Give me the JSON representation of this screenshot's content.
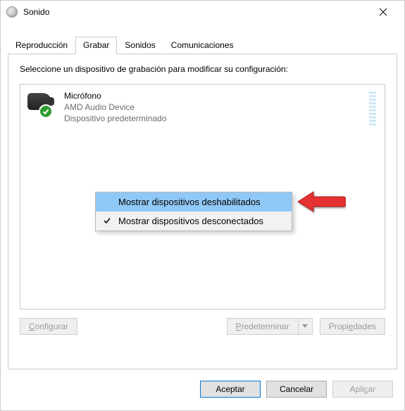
{
  "window": {
    "title": "Sonido"
  },
  "tabs": {
    "playback": "Reproducción",
    "record": "Grabar",
    "sounds": "Sonidos",
    "comms": "Comunicaciones"
  },
  "page": {
    "instruction": "Seleccione un dispositivo de grabación para modificar su configuración:",
    "device": {
      "name": "Micrófono",
      "driver": "AMD Audio Device",
      "status": "Dispositivo predeterminado"
    },
    "buttons": {
      "configure": "Configurar",
      "setdefault": "Predeterminar",
      "properties": "Propiedades"
    }
  },
  "context_menu": {
    "show_disabled": "Mostrar dispositivos deshabilitados",
    "show_disconnected": "Mostrar dispositivos desconectados"
  },
  "dialog_buttons": {
    "ok": "Aceptar",
    "cancel": "Cancelar",
    "apply": "Aplicar"
  }
}
